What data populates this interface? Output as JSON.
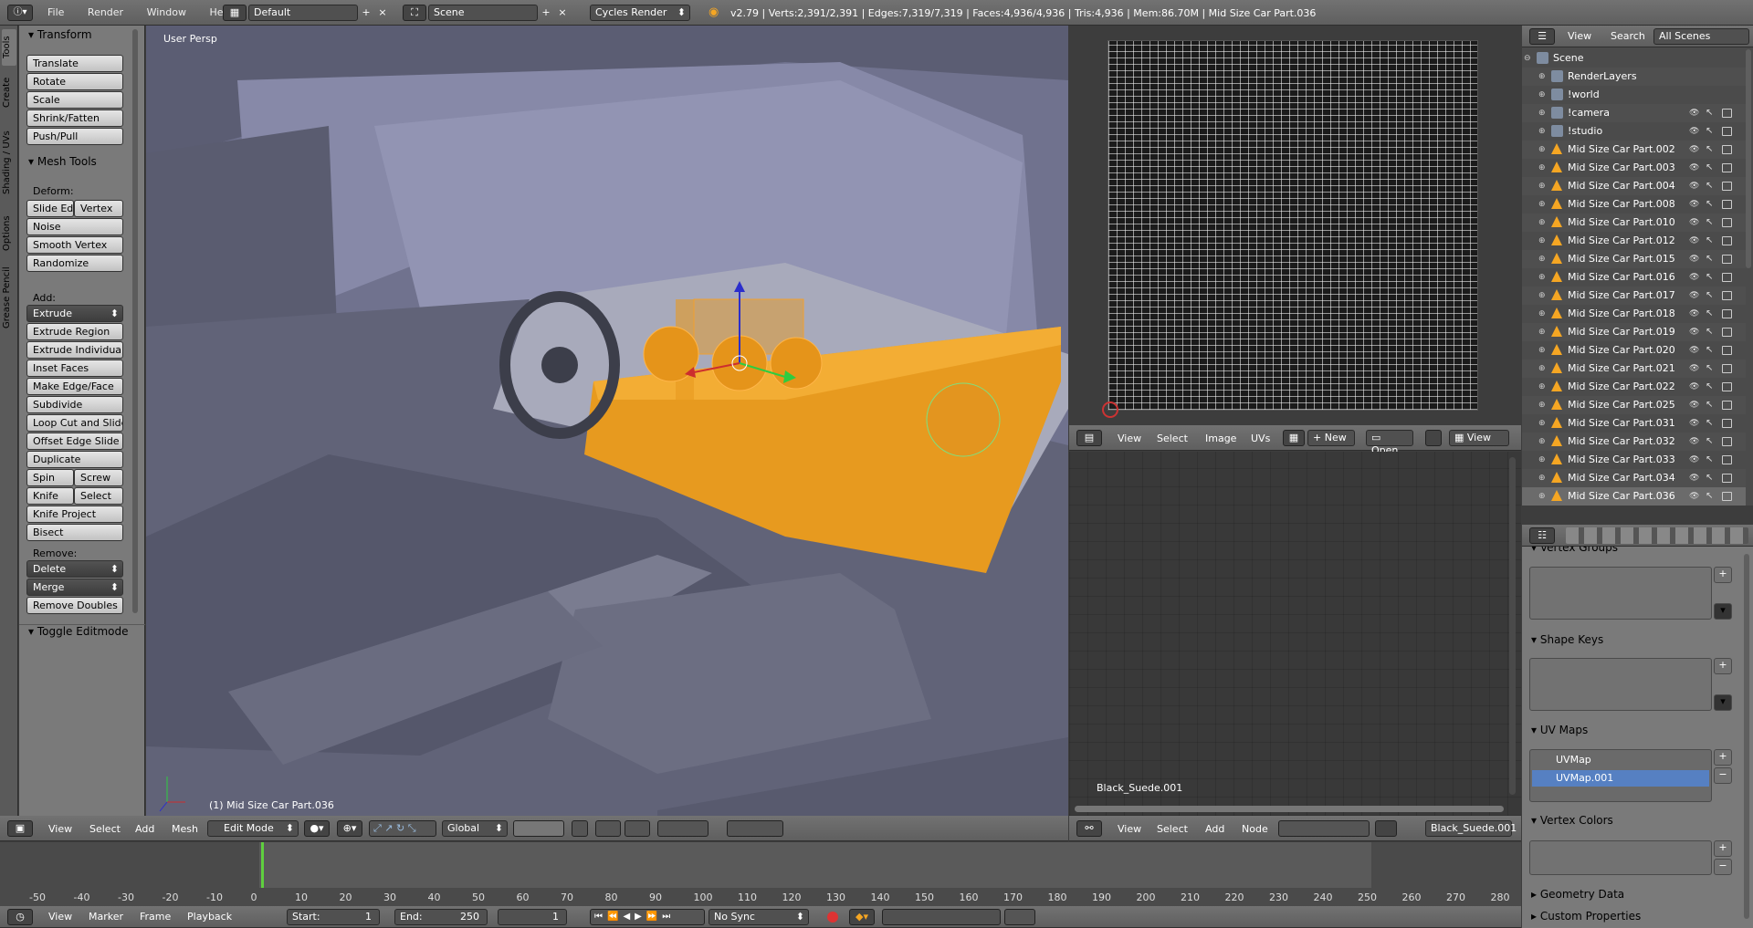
{
  "topbar": {
    "menus": [
      "File",
      "Render",
      "Window",
      "Help"
    ],
    "layout": "Default",
    "scene": "Scene",
    "engine": "Cycles Render",
    "stats": "v2.79 | Verts:2,391/2,391 | Edges:7,319/7,319 | Faces:4,936/4,936 | Tris:4,936 | Mem:86.70M | Mid Size Car Part.036"
  },
  "tool_tabs": [
    "Tools",
    "Create",
    "Shading / UVs",
    "Options",
    "Grease Pencil"
  ],
  "toolshelf": {
    "transform_title": "Transform",
    "transform": [
      "Translate",
      "Rotate",
      "Scale",
      "Shrink/Fatten",
      "Push/Pull"
    ],
    "mesh_tools_title": "Mesh Tools",
    "deform_label": "Deform:",
    "deform_pair": [
      "Slide Ed",
      "Vertex"
    ],
    "deform": [
      "Noise",
      "Smooth Vertex",
      "Randomize"
    ],
    "add_label": "Add:",
    "extrude": "Extrude",
    "add": [
      "Extrude Region",
      "Extrude Individual",
      "Inset Faces",
      "Make Edge/Face",
      "Subdivide",
      "Loop Cut and Slide",
      "Offset Edge Slide",
      "Duplicate"
    ],
    "spin": "Spin",
    "screw": "Screw",
    "knife": "Knife",
    "select": "Select",
    "add2": [
      "Knife Project",
      "Bisect"
    ],
    "remove_label": "Remove:",
    "delete": "Delete",
    "merge": "Merge",
    "remove_doubles": "Remove Doubles",
    "toggle_editmode": "Toggle Editmode"
  },
  "viewport": {
    "label": "User Persp",
    "object_label": "(1) Mid Size Car Part.036"
  },
  "view3d_header": {
    "menus": [
      "View",
      "Select",
      "Add",
      "Mesh"
    ],
    "mode": "Edit Mode",
    "orientation": "Global"
  },
  "uv_editor": {
    "menus": [
      "View",
      "Select",
      "Image",
      "UVs"
    ],
    "new": "New",
    "open": "Open",
    "view": "View"
  },
  "node_editor": {
    "menus": [
      "View",
      "Select",
      "Add",
      "Node"
    ],
    "material": "Black_Suede.001",
    "label": "Black_Suede.001"
  },
  "outliner": {
    "menus": [
      "View",
      "Search"
    ],
    "display": "All Scenes",
    "items": [
      "Scene",
      "RenderLayers",
      "!world",
      "!camera",
      "!studio",
      "Mid Size Car Part.002",
      "Mid Size Car Part.003",
      "Mid Size Car Part.004",
      "Mid Size Car Part.008",
      "Mid Size Car Part.010",
      "Mid Size Car Part.012",
      "Mid Size Car Part.015",
      "Mid Size Car Part.016",
      "Mid Size Car Part.017",
      "Mid Size Car Part.018",
      "Mid Size Car Part.019",
      "Mid Size Car Part.020",
      "Mid Size Car Part.021",
      "Mid Size Car Part.022",
      "Mid Size Car Part.025",
      "Mid Size Car Part.031",
      "Mid Size Car Part.032",
      "Mid Size Car Part.033",
      "Mid Size Car Part.034",
      "Mid Size Car Part.036"
    ]
  },
  "properties": {
    "vertex_groups": "Vertex Groups",
    "shape_keys": "Shape Keys",
    "uv_maps": "UV Maps",
    "uvmaps": [
      "UVMap",
      "UVMap.001"
    ],
    "vertex_colors": "Vertex Colors",
    "geometry_data": "Geometry Data",
    "custom_properties": "Custom Properties"
  },
  "timeline": {
    "ticks": [
      "-50",
      "-40",
      "-30",
      "-20",
      "-10",
      "0",
      "10",
      "20",
      "30",
      "40",
      "50",
      "60",
      "70",
      "80",
      "90",
      "100",
      "110",
      "120",
      "130",
      "140",
      "150",
      "160",
      "170",
      "180",
      "190",
      "200",
      "210",
      "220",
      "230",
      "240",
      "250",
      "260",
      "270",
      "280"
    ],
    "menus": [
      "View",
      "Marker",
      "Frame",
      "Playback"
    ],
    "start_label": "Start:",
    "start": "1",
    "end_label": "End:",
    "end": "250",
    "current": "1",
    "sync": "No Sync"
  }
}
